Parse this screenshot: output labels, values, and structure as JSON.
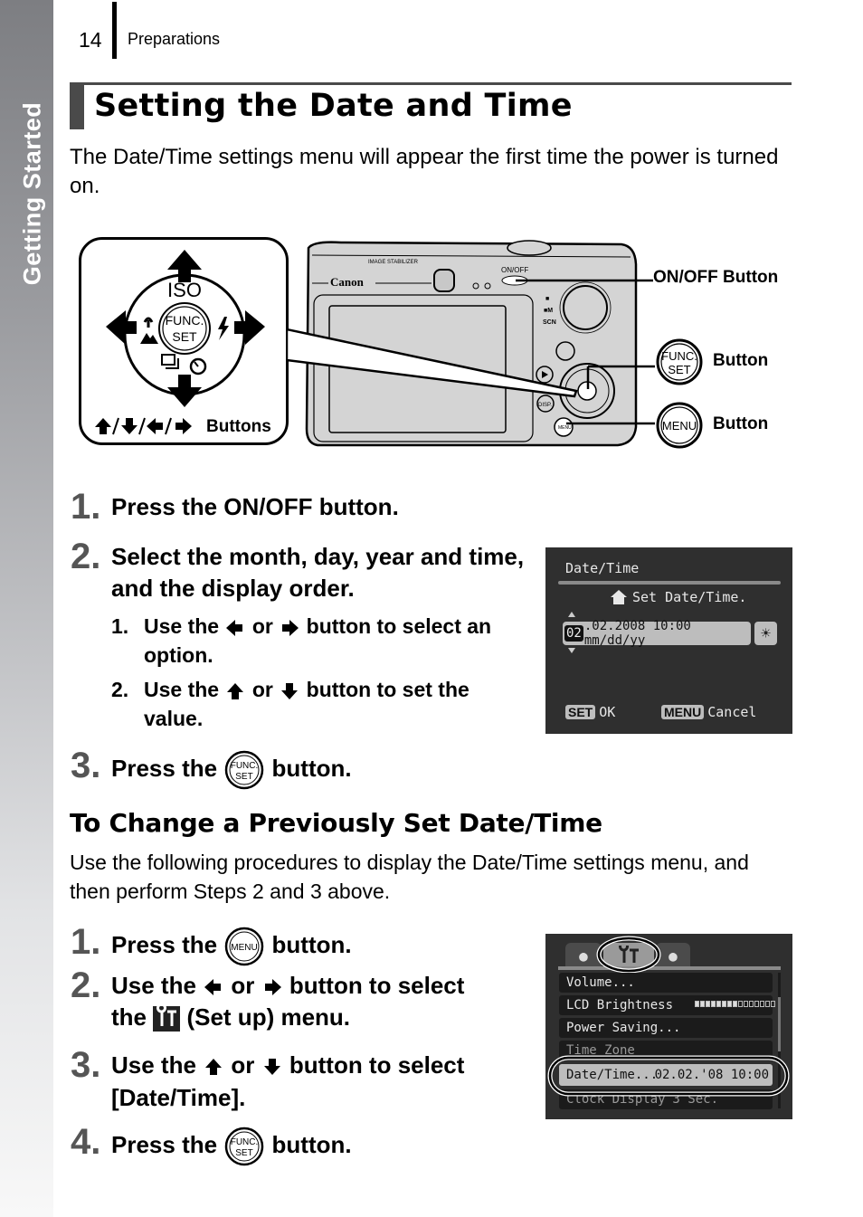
{
  "sidebar": {
    "label": "Getting Started"
  },
  "header": {
    "page_number": "14",
    "section": "Preparations"
  },
  "page_title": "Setting the Date and Time",
  "intro": "The Date/Time settings menu will appear the first time the power is turned on.",
  "diagram": {
    "dpad": {
      "top_label": "ISO",
      "center_label_line1": "FUNC.",
      "center_label_line2": "SET",
      "buttons_label": "Buttons",
      "arrow_icons": [
        "up-arrow",
        "down-arrow",
        "left-arrow",
        "right-arrow"
      ]
    },
    "camera": {
      "brand": "Canon",
      "onoff_marking": "ON/OFF",
      "stabilizer_marking": "IMAGE STABILIZER",
      "mode_marks": [
        "AUTO",
        "M",
        "SCN",
        "MOVIE"
      ],
      "disp_marking": "DISP.",
      "menu_marking": "MENU"
    },
    "callouts": [
      {
        "id": "onoff",
        "label": "ON/OFF Button"
      },
      {
        "id": "func",
        "icon_line1": "FUNC.",
        "icon_line2": "SET",
        "label": "Button"
      },
      {
        "id": "menu",
        "icon_text": "MENU",
        "label": "Button"
      }
    ]
  },
  "steps_initial": [
    {
      "num": "1.",
      "text": "Press the ON/OFF button."
    },
    {
      "num": "2.",
      "text": "Select the month, day, year and time, and the display order.",
      "sub_steps": [
        {
          "num": "1.",
          "pre": "Use the",
          "mid": "or",
          "post": "button to select an option.",
          "icons": [
            "left-arrow",
            "right-arrow"
          ]
        },
        {
          "num": "2.",
          "pre": "Use the",
          "mid": "or",
          "post": "button to set the value.",
          "icons": [
            "up-arrow",
            "down-arrow"
          ]
        }
      ]
    },
    {
      "num": "3.",
      "pre": "Press the",
      "post": "button.",
      "icon": "func-set"
    }
  ],
  "lcd_datetime": {
    "title": "Date/Time",
    "hint": "Set Date/Time.",
    "selected_field": "02",
    "value_rest": ".02.2008 10:00 mm/dd/yy",
    "dst_icon": "sun-icon",
    "ok_key": "SET",
    "ok_label": "OK",
    "cancel_key": "MENU",
    "cancel_label": "Cancel"
  },
  "change_section": {
    "heading": "To Change a Previously Set Date/Time",
    "intro": "Use the following procedures to display the Date/Time settings menu, and then perform Steps 2 and 3 above.",
    "steps": [
      {
        "num": "1.",
        "pre": "Press the",
        "post": "button.",
        "icon": "menu"
      },
      {
        "num": "2.",
        "pre": "Use the",
        "mid": "or",
        "post": "button to select",
        "line2_pre": "the",
        "line2_post": "(Set up) menu.",
        "icons": [
          "left-arrow",
          "right-arrow",
          "setup"
        ]
      },
      {
        "num": "3.",
        "pre": "Use the",
        "mid": "or",
        "post": "button to select",
        "line2": "[Date/Time].",
        "icons": [
          "up-arrow",
          "down-arrow"
        ]
      },
      {
        "num": "4.",
        "pre": "Press the",
        "post": "button.",
        "icon": "func-set"
      }
    ]
  },
  "lcd_menu": {
    "tabs": [
      "camera",
      "setup",
      "my-settings"
    ],
    "active_tab": "setup",
    "rows": [
      {
        "label": "Volume...",
        "value": ""
      },
      {
        "label": "LCD Brightness",
        "value": "",
        "brightness_level": 8,
        "brightness_max": 15
      },
      {
        "label": "Power Saving...",
        "value": ""
      },
      {
        "label": "Time Zone",
        "value": ""
      },
      {
        "label": "Date/Time...",
        "value": "02.02.'08 10:00",
        "selected": true
      },
      {
        "label": "Clock Display",
        "value": "3 Sec."
      }
    ]
  }
}
